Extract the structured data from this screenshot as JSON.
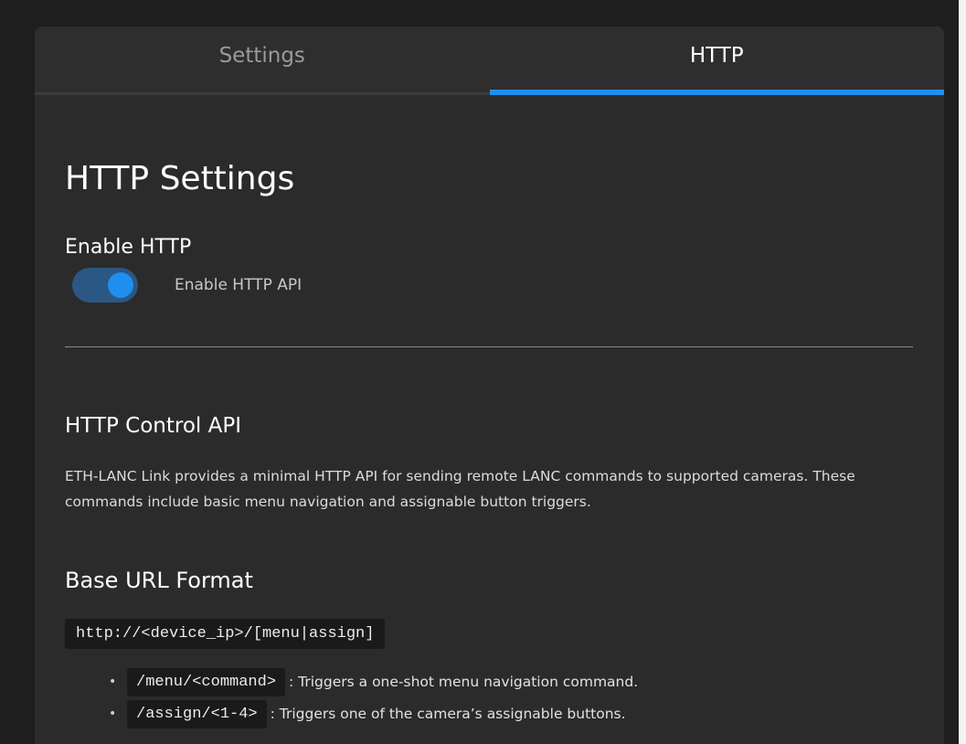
{
  "tabs": [
    {
      "label": "Settings",
      "active": false
    },
    {
      "label": "HTTP",
      "active": true
    }
  ],
  "page_title": "HTTP Settings",
  "enable_section": {
    "title": "Enable HTTP",
    "toggle_label": "Enable HTTP API",
    "toggle_on": true
  },
  "api_section": {
    "title": "HTTP Control API",
    "description": "ETH-LANC Link provides a minimal HTTP API for sending remote LANC commands to supported cameras. These commands include basic menu navigation and assignable button triggers."
  },
  "base_section": {
    "title": "Base URL Format",
    "url": "http://<device_ip>/[menu|assign]",
    "endpoints": [
      {
        "path": "/menu/<command>",
        "text": ": Triggers a one-shot menu navigation command."
      },
      {
        "path": "/assign/<1-4>",
        "text": ": Triggers one of the camera’s assignable buttons."
      }
    ]
  },
  "colors": {
    "accent": "#1e8ff0",
    "background": "#2b2b2b",
    "toggle_track": "#2a5783"
  }
}
